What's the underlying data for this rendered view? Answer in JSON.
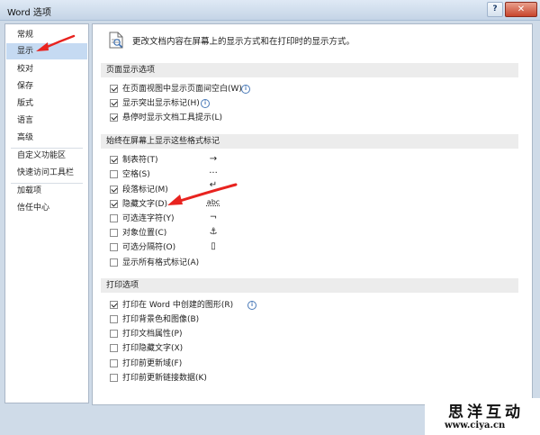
{
  "window": {
    "title": "Word 选项",
    "help_label": "?",
    "close_label": "✕"
  },
  "sidebar": {
    "items": [
      {
        "label": "常规",
        "active": false
      },
      {
        "label": "显示",
        "active": true
      },
      {
        "label": "校对",
        "active": false
      },
      {
        "label": "保存",
        "active": false
      },
      {
        "label": "版式",
        "active": false
      },
      {
        "label": "语言",
        "active": false
      },
      {
        "label": "高级",
        "active": false
      },
      {
        "label": "自定义功能区",
        "active": false
      },
      {
        "label": "快速访问工具栏",
        "active": false
      },
      {
        "label": "加载项",
        "active": false
      },
      {
        "label": "信任中心",
        "active": false
      }
    ]
  },
  "main": {
    "intro": "更改文档内容在屏幕上的显示方式和在打印时的显示方式。",
    "sections": {
      "page_display": {
        "title": "页面显示选项",
        "options": [
          {
            "label": "在页面视图中显示页面间空白(W)",
            "checked": true,
            "info": true
          },
          {
            "label": "显示突出显示标记(H)",
            "checked": true,
            "info": true
          },
          {
            "label": "悬停时显示文档工具提示(L)",
            "checked": true,
            "info": false
          }
        ]
      },
      "format_marks": {
        "title": "始终在屏幕上显示这些格式标记",
        "options": [
          {
            "label": "制表符(T)",
            "checked": true,
            "symbol": "→"
          },
          {
            "label": "空格(S)",
            "checked": false,
            "symbol": "···"
          },
          {
            "label": "段落标记(M)",
            "checked": true,
            "symbol": "↵"
          },
          {
            "label": "隐藏文字(D)",
            "checked": true,
            "symbol": "abc"
          },
          {
            "label": "可选连字符(Y)",
            "checked": false,
            "symbol": "¬"
          },
          {
            "label": "对象位置(C)",
            "checked": false,
            "symbol": "⚓"
          },
          {
            "label": "可选分隔符(O)",
            "checked": false,
            "symbol": "▯"
          },
          {
            "label": "显示所有格式标记(A)",
            "checked": false,
            "symbol": ""
          }
        ]
      },
      "print": {
        "title": "打印选项",
        "options": [
          {
            "label": "打印在 Word 中创建的图形(R)",
            "checked": true,
            "info": true
          },
          {
            "label": "打印背景色和图像(B)",
            "checked": false,
            "info": false
          },
          {
            "label": "打印文档属性(P)",
            "checked": false,
            "info": false
          },
          {
            "label": "打印隐藏文字(X)",
            "checked": false,
            "info": false
          },
          {
            "label": "打印前更新域(F)",
            "checked": false,
            "info": false
          },
          {
            "label": "打印前更新链接数据(K)",
            "checked": false,
            "info": false
          }
        ]
      }
    }
  },
  "watermark": {
    "name": "思洋互动",
    "url": "www.ciya.cn"
  },
  "colors": {
    "accent_arrow": "#e8231f",
    "active_nav": "#c5daf2",
    "section_bg": "#ececec"
  }
}
